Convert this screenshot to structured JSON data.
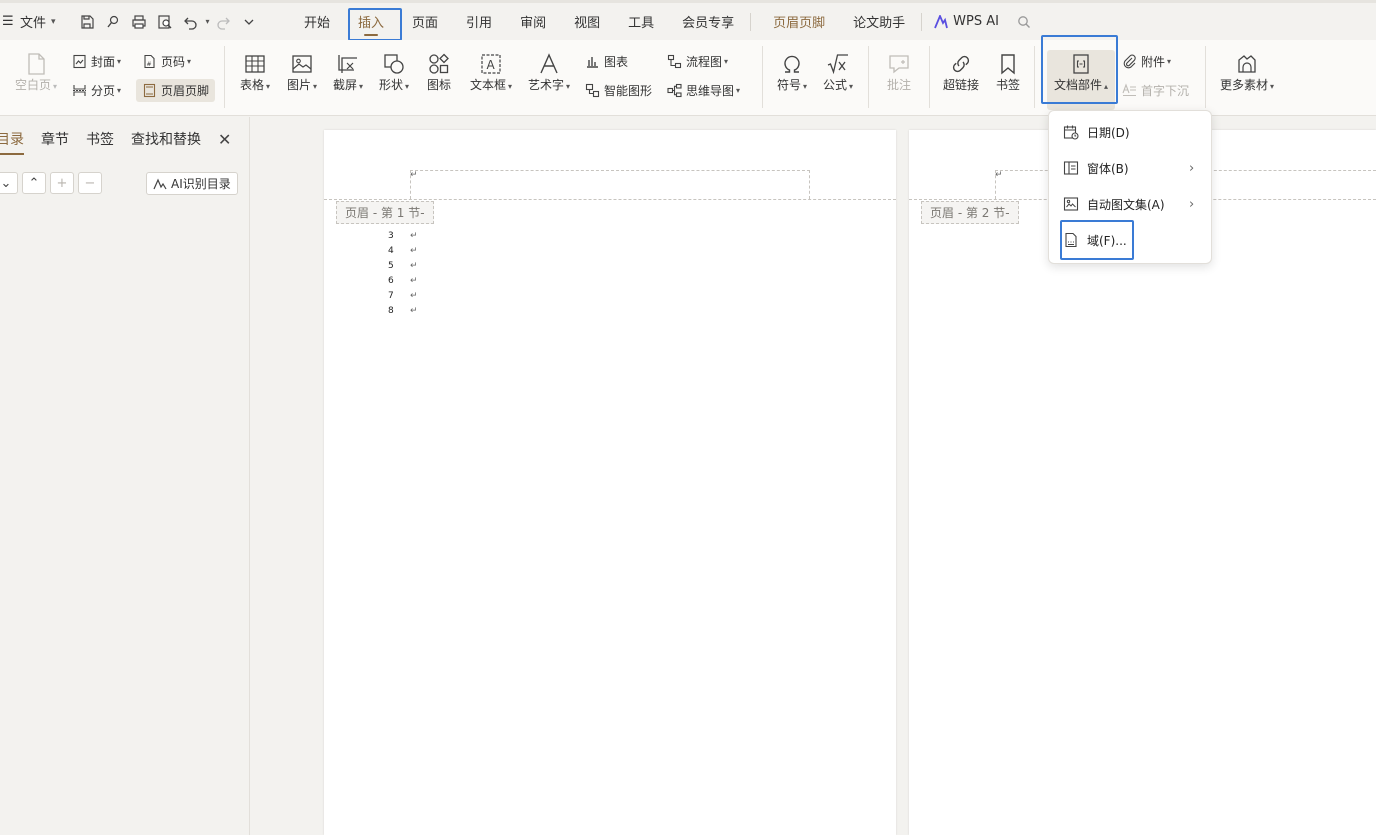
{
  "menubar": {
    "file_label": "文件",
    "tabs": [
      "开始",
      "插入",
      "页面",
      "引用",
      "审阅",
      "视图",
      "工具",
      "会员专享",
      "页眉页脚",
      "论文助手"
    ],
    "active_tab": "插入",
    "wps_ai": "WPS AI"
  },
  "ribbon": {
    "blank_page": "空白页",
    "cover": "封面",
    "page_number": "页码",
    "page_break": "分页",
    "header_footer": "页眉页脚",
    "table": "表格",
    "picture": "图片",
    "screenshot": "截屏",
    "shape": "形状",
    "icon": "图标",
    "text_box": "文本框",
    "word_art": "艺术字",
    "chart": "图表",
    "smart_art": "智能图形",
    "flowchart": "流程图",
    "mind_map": "思维导图",
    "symbol": "符号",
    "formula": "公式",
    "comment": "批注",
    "hyperlink": "超链接",
    "bookmark": "书签",
    "doc_parts": "文档部件",
    "attachment": "附件",
    "drop_cap": "首字下沉",
    "more_material": "更多素材"
  },
  "leftpanel": {
    "tabs": [
      "目录",
      "章节",
      "书签",
      "查找和替换"
    ],
    "ai_button": "AI识别目录"
  },
  "document": {
    "page1_header_tag": "页眉  - 第 1 节-",
    "page2_header_tag": "页眉  - 第 2 节-",
    "para_mark": "↵",
    "line_numbers": [
      "3",
      "4",
      "5",
      "6",
      "7",
      "8"
    ]
  },
  "dropdown": {
    "items": [
      {
        "label": "日期(D)",
        "submenu": false
      },
      {
        "label": "窗体(B)",
        "submenu": true
      },
      {
        "label": "自动图文集(A)",
        "submenu": true
      },
      {
        "label": "域(F)...",
        "submenu": false
      }
    ]
  },
  "colors": {
    "accent": "#8c6a3f",
    "highlight": "#3a7bd5"
  }
}
